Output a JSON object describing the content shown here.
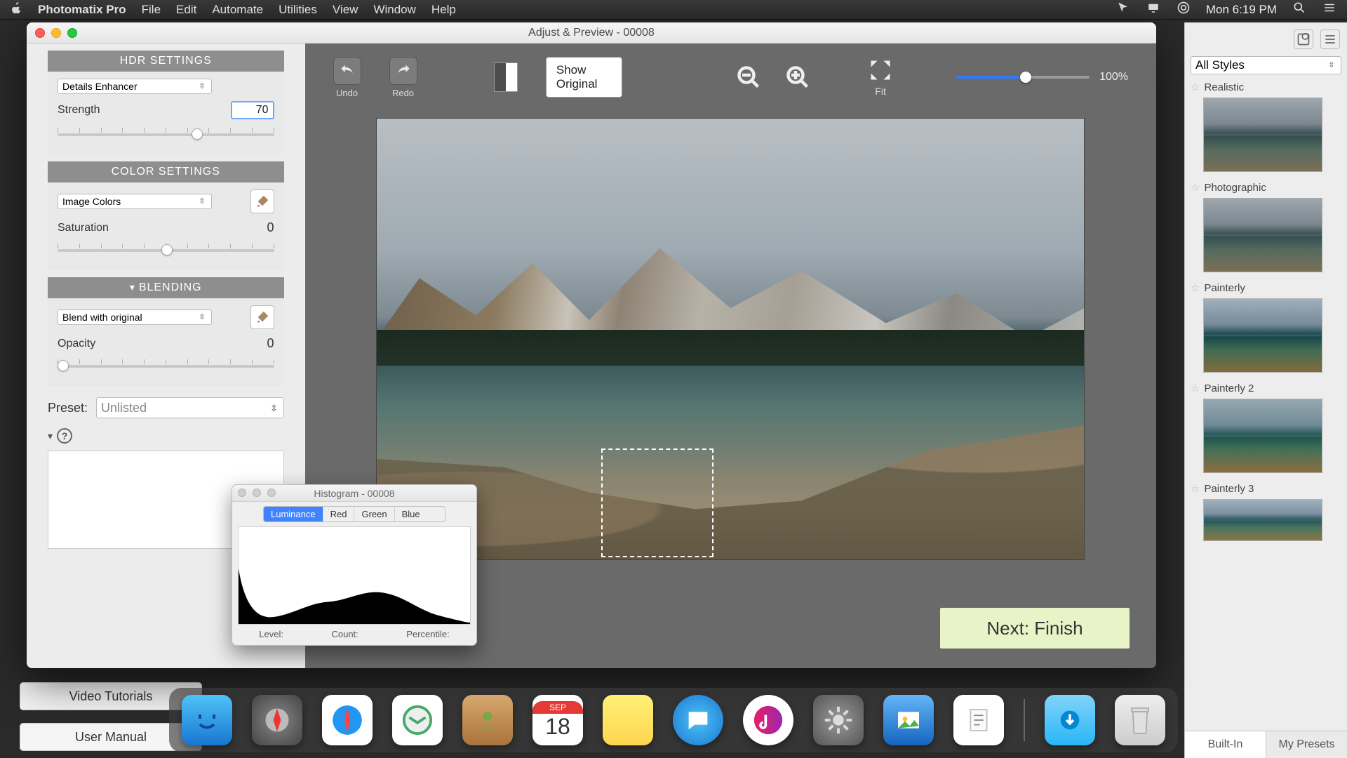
{
  "menubar": {
    "app": "Photomatix Pro",
    "items": [
      "File",
      "Edit",
      "Automate",
      "Utilities",
      "View",
      "Window",
      "Help"
    ],
    "clock": "Mon 6:19 PM"
  },
  "window": {
    "title": "Adjust & Preview - 00008"
  },
  "hdr": {
    "header": "HDR SETTINGS",
    "method": "Details Enhancer",
    "strength_label": "Strength",
    "strength_value": "70"
  },
  "color": {
    "header": "COLOR SETTINGS",
    "mode": "Image Colors",
    "sat_label": "Saturation",
    "sat_value": "0"
  },
  "blend": {
    "header": "BLENDING",
    "mode": "Blend with original",
    "opacity_label": "Opacity",
    "opacity_value": "0"
  },
  "preset_row": {
    "label": "Preset:",
    "value": "Unlisted"
  },
  "toolbar": {
    "undo": "Undo",
    "redo": "Redo",
    "show_original": "Show Original",
    "fit": "Fit",
    "zoom_pct": "100%"
  },
  "next_button": "Next: Finish",
  "help_pills": {
    "tutorials": "Video Tutorials",
    "manual": "User Manual"
  },
  "histogram": {
    "title": "Histogram - 00008",
    "tabs": [
      "Luminance",
      "Red",
      "Green",
      "Blue"
    ],
    "stats": {
      "level": "Level:",
      "count": "Count:",
      "percentile": "Percentile:"
    }
  },
  "styles": {
    "filter": "All Styles",
    "items": [
      "Realistic",
      "Photographic",
      "Painterly",
      "Painterly 2",
      "Painterly 3"
    ],
    "tabs": {
      "builtin": "Built-In",
      "mine": "My Presets"
    }
  },
  "dock": {
    "apps": [
      "finder",
      "launchpad",
      "safari",
      "mail",
      "contacts",
      "calendar",
      "notes",
      "messages",
      "music",
      "settings",
      "preview",
      "textedit",
      "downloads",
      "trash"
    ],
    "cal_month": "SEP",
    "cal_day": "18"
  }
}
